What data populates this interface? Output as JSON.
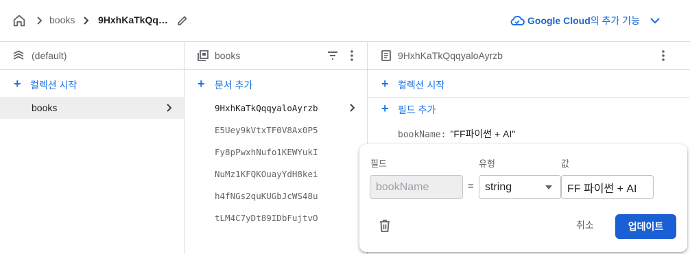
{
  "breadcrumb": {
    "home_icon": "home-icon",
    "items": [
      "books",
      "9HxhKaTkQqqy…"
    ]
  },
  "google_cloud": {
    "icon": "cloud-icon",
    "brand": "Google Cloud",
    "suffix": "의 추가 기능"
  },
  "columns": {
    "root": {
      "title": "(default)",
      "icon": "database-stack-icon",
      "action": "컬렉션 시작",
      "items": [
        "books"
      ]
    },
    "collection": {
      "title": "books",
      "icon": "collection-icon",
      "action": "문서 추가",
      "documents": [
        "9HxhKaTkQqqyaloAyrzb",
        "E5Uey9kVtxTF0V8Ax0P5",
        "Fy8pPwxhNufo1KEWYukI",
        "NuMz1KFQKOuayYdH8kei",
        "h4fNGs2quKUGbJcWS48u",
        "tLM4C7yDt89IDbFujtvO"
      ]
    },
    "document": {
      "title": "9HxhKaTkQqqyaloAyrzb",
      "icon": "document-icon",
      "action_collection": "컬렉션 시작",
      "action_field": "필드 추가",
      "field_name": "bookName:",
      "field_value": "\"FF파이썬 + AI\""
    }
  },
  "editor": {
    "label_field": "필드",
    "label_type": "유형",
    "label_value": "값",
    "field_placeholder": "bookName",
    "equals": "=",
    "type_value": "string",
    "value": "FF 파이썬 + AI",
    "cancel": "취소",
    "update": "업데이트"
  },
  "colors": {
    "accent": "#1a73e8",
    "primary_button": "#1a5fd3",
    "selected_row": "#eeeeee",
    "border": "#dadce0"
  }
}
